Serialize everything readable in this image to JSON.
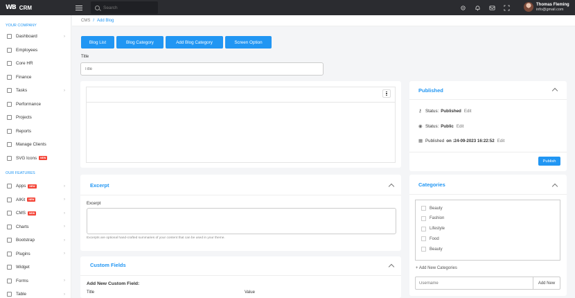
{
  "header": {
    "brand_logo": "WB",
    "brand_name": "CRM",
    "search_placeholder": "Search",
    "user_name": "Thomas Fleming",
    "user_email": "info@gmail.com",
    "icons": [
      "gear-icon",
      "bell-icon",
      "mail-icon",
      "fullscreen-icon"
    ]
  },
  "sidebar": {
    "section1_title": "YOUR COMPANY",
    "section2_title": "OUR FEATURES",
    "badge_text": "NEW",
    "company_items": [
      {
        "label": "Dashboard",
        "chevron": true,
        "badge": false
      },
      {
        "label": "Employees",
        "chevron": false,
        "badge": false
      },
      {
        "label": "Core HR",
        "chevron": false,
        "badge": false
      },
      {
        "label": "Finance",
        "chevron": false,
        "badge": false
      },
      {
        "label": "Tasks",
        "chevron": true,
        "badge": false
      },
      {
        "label": "Performance",
        "chevron": false,
        "badge": false
      },
      {
        "label": "Projects",
        "chevron": false,
        "badge": false
      },
      {
        "label": "Reports",
        "chevron": false,
        "badge": false
      },
      {
        "label": "Manage Clients",
        "chevron": false,
        "badge": false
      },
      {
        "label": "SVG Icons",
        "chevron": false,
        "badge": true
      }
    ],
    "feature_items": [
      {
        "label": "Apps",
        "chevron": true,
        "badge": true
      },
      {
        "label": "AIKit",
        "chevron": true,
        "badge": true
      },
      {
        "label": "CMS",
        "chevron": true,
        "badge": true
      },
      {
        "label": "Charts",
        "chevron": true,
        "badge": false
      },
      {
        "label": "Bootstrap",
        "chevron": true,
        "badge": false
      },
      {
        "label": "Plugins",
        "chevron": true,
        "badge": false
      },
      {
        "label": "Widget",
        "chevron": false,
        "badge": false
      },
      {
        "label": "Forms",
        "chevron": true,
        "badge": false
      },
      {
        "label": "Table",
        "chevron": true,
        "badge": false
      }
    ]
  },
  "breadcrumb": {
    "parent": "CMS",
    "separator": "/",
    "current": "Add Blog"
  },
  "tabs": [
    "Blog List",
    "Blog Category",
    "Add Blog Category",
    "Screen Option"
  ],
  "title_field": {
    "label": "Title",
    "placeholder": "Title",
    "value": ""
  },
  "excerpt": {
    "card_title": "Excerpt",
    "label": "Excerpt",
    "help": "Excerpts are optional hand-crafted summaries of your content that can be used in your theme."
  },
  "custom_fields": {
    "card_title": "Custom Fields",
    "heading": "Add New Custom Field:",
    "col_title": "Title",
    "col_value": "Value"
  },
  "published": {
    "card_title": "Published",
    "status_label": "Status:",
    "status_value": "Published",
    "visibility_label": "Status:",
    "visibility_value": "Public",
    "date_label": "Published",
    "date_value": "on :24-09-2023 16:22:52",
    "edit_label": "Edit",
    "publish_button": "Publish"
  },
  "categories": {
    "card_title": "Categories",
    "items": [
      "Beauty",
      "Fashion",
      "Lifestyle",
      "Food",
      "Beauty"
    ],
    "add_link": "+ Add New Categories",
    "input_placeholder": "Username",
    "add_button": "Add New"
  }
}
